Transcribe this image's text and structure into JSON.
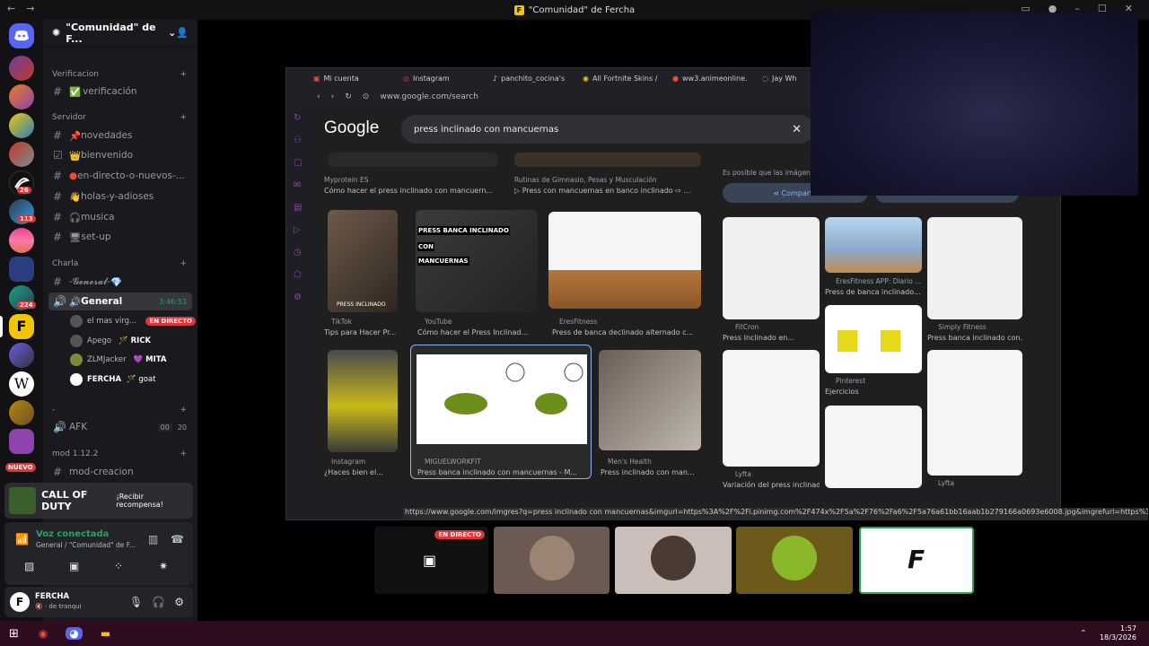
{
  "window": {
    "title": "\"Comunidad\" de Fercha"
  },
  "guild": {
    "name": "\"Comunidad\" de F..."
  },
  "server_badges": {
    "s1": "26",
    "s2": "113",
    "s3": "224",
    "nuevo": "NUEVO"
  },
  "categories": {
    "verificacion": "Verificacion",
    "servidor": "Servidor",
    "charla": "Charla",
    "blank": "-",
    "mod": "mod 1.12.2"
  },
  "channels": {
    "verificacion": "verificación",
    "novedades": "novedades",
    "bienvenido": "bienvenido",
    "en_directo": "en-directo-o-nuevos-...",
    "holas": "holas-y-adioses",
    "musica": "musica",
    "setup": "set-up",
    "general_text": "-𝓖𝓮𝓷𝓮𝓻𝓪𝓵-",
    "general_voice": "General",
    "general_timer": "3:46:53",
    "afk": "AFK",
    "afk_count": "00",
    "afk_limit": "20",
    "mod_creacion": "mod-creacion"
  },
  "voice_users": [
    {
      "name": "el mas virg...",
      "status": "EN DIRECTO"
    },
    {
      "name": "Apego",
      "status": "RICK"
    },
    {
      "name": "ZLMJacker",
      "status": "MITA"
    },
    {
      "name": "FERCHA",
      "status": "goat"
    }
  ],
  "promo": {
    "game": "CALL OF DUTY",
    "action": "¡Recibir recompensa!"
  },
  "voice": {
    "status": "Voz conectada",
    "channel": "General / \"Comunidad\" de F..."
  },
  "user": {
    "name": "FERCHA",
    "status": "de tranqui"
  },
  "browser": {
    "tabs": [
      "Mi cuenta",
      "Instagram",
      "panchito_cocina's",
      "All Fortnite Skins /",
      "ww3.animeonline.",
      "Jay Wh"
    ],
    "url": "www.google.com/search"
  },
  "google": {
    "logo": "Google",
    "query": "press inclinado con mancuernas",
    "note": "Es posible que las imágenes",
    "share": "Compartir"
  },
  "results": [
    {
      "source": "Myprotein ES",
      "title": "Cómo hacer el press inclinado con mancuern..."
    },
    {
      "source": "Rutinas de Gimnasio, Pesas y Musculación",
      "title": "▷ Press con mancuernas en banco inclinado ⇨ ..."
    },
    {
      "source": "TikTok",
      "title": "Tips para Hacer Pr..."
    },
    {
      "source": "YouTube",
      "title": "Cómo hacer el Press Inclinad..."
    },
    {
      "source": "EresFitness",
      "title": "Press de banca declinado alternado c..."
    },
    {
      "source": "Instagram",
      "title": "¿Haces bien el..."
    },
    {
      "source": "MIGUELWORKFIT",
      "title": "Press banca inclinado con mancuernas - M..."
    },
    {
      "source": "Men's Health",
      "title": "Press inclinado con man..."
    }
  ],
  "thumb_text": {
    "yt": "PRESS BANCA INCLINADO",
    "yt2": "CON",
    "yt3": "MANCUERNAS",
    "tiktok": "PRESS INCLINADO"
  },
  "side_results": [
    {
      "source": "FitCron",
      "title": "Press Inclinado en..."
    },
    {
      "source": "EresFitness APP: Diario ...",
      "title": "Press de banca inclinado..."
    },
    {
      "source": "Simply Fitness",
      "title": "Press banca inclinado con..."
    },
    {
      "source": "Pinterest",
      "title": "Ejercicios"
    },
    {
      "source": "Lyfta",
      "title": "Variación del press inclinad..."
    },
    {
      "source": "Lyfta",
      "title": ""
    }
  ],
  "status_url": "https://www.google.com/imgres?q=press inclinado con mancuernas&imgurl=https%3A%2F%2Fi.pinimg.com%2F474x%2F5a%2F76%2Fa6%2F5a76a61bb16aab1b279166a0693e6008.jpg&imgrefurl=https%3A...",
  "stream": {
    "live": "EN DIRECTO",
    "f_letter": "F"
  },
  "clock": {
    "time": "1:57",
    "date": "18/3/2026"
  }
}
